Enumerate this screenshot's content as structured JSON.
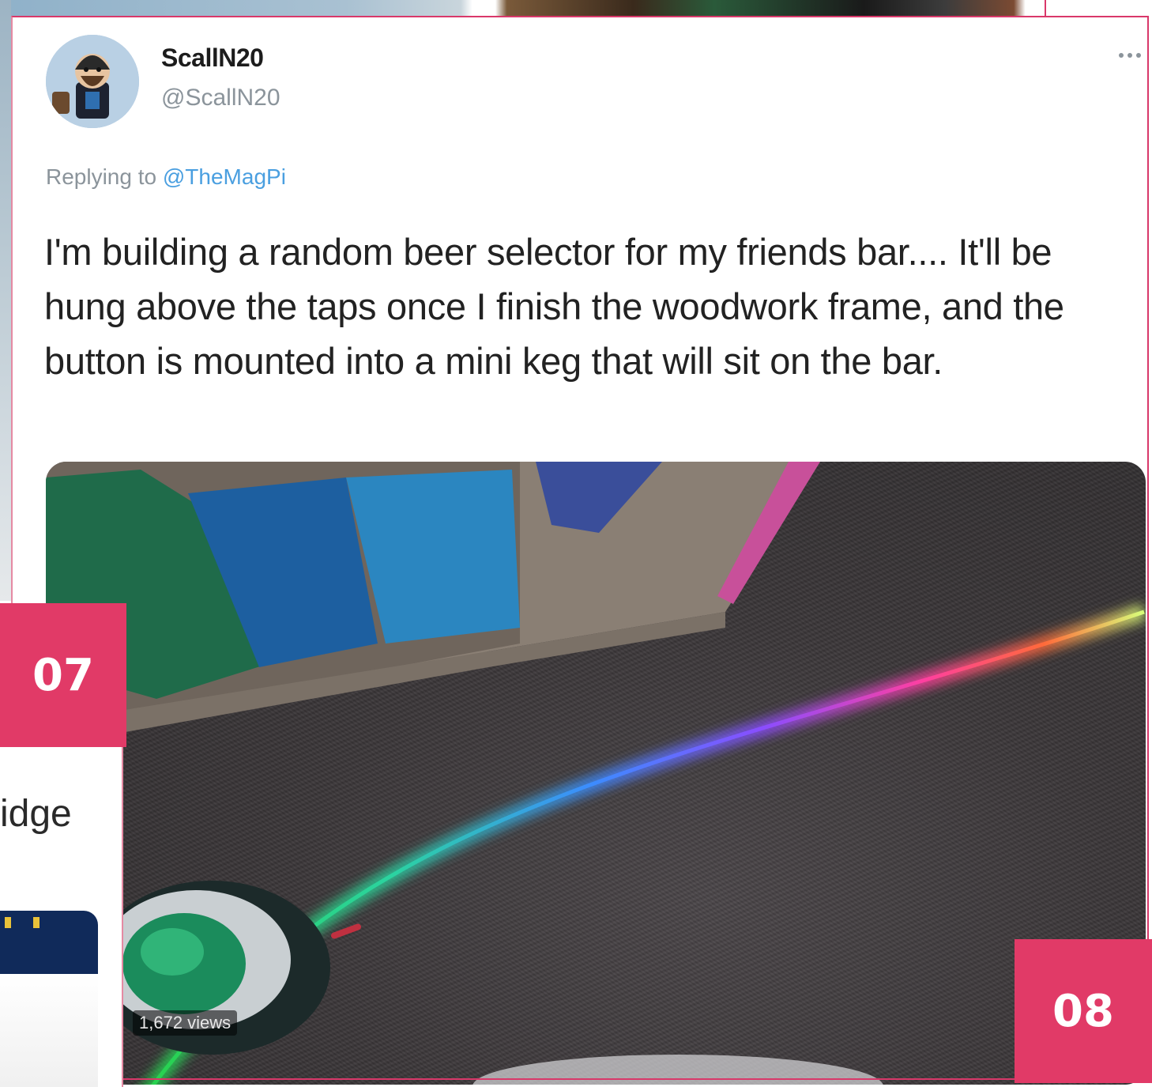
{
  "tweet": {
    "display_name": "ScallN20",
    "handle": "@ScallN20",
    "reply_prefix": "Replying to",
    "reply_target": "@TheMagPi",
    "text": "I'm building a random beer selector for my friends bar.... It'll be hung above the taps once I finish the woodwork frame, and the button is mounted into a mini keg that will sit on the bar.",
    "views": "1,672 views",
    "more_icon": "ellipsis-icon"
  },
  "magazine": {
    "tab_07": "07",
    "tab_08": "08",
    "side_fragment": "idge",
    "accent_color": "#e13a67"
  }
}
